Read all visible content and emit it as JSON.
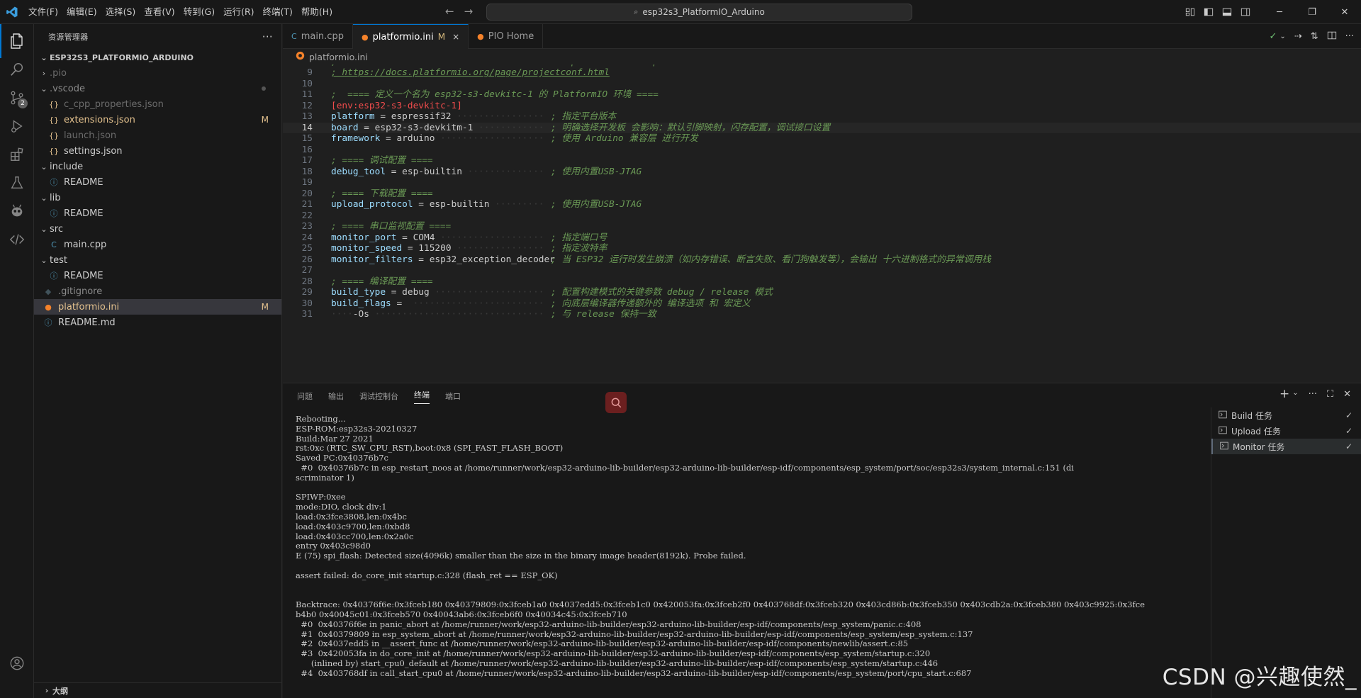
{
  "menu": [
    "文件(F)",
    "编辑(E)",
    "选择(S)",
    "查看(V)",
    "转到(G)",
    "运行(R)",
    "终端(T)",
    "帮助(H)"
  ],
  "search": {
    "text": "esp32s3_PlatformIO_Arduino"
  },
  "sidebar": {
    "title": "资源管理器",
    "more": "···",
    "project": "ESP32S3_PLATFORMIO_ARDUINO",
    "outline": "大纲"
  },
  "tree": [
    {
      "label": ".pio",
      "depth": 1,
      "type": "folder",
      "open": false,
      "color": "#6b6b6b"
    },
    {
      "label": ".vscode",
      "depth": 1,
      "type": "folder",
      "open": true,
      "color": "#8a8a8a",
      "dot": true
    },
    {
      "label": "c_cpp_properties.json",
      "depth": 2,
      "type": "json",
      "color": "#6b6b6b"
    },
    {
      "label": "extensions.json",
      "depth": 2,
      "type": "json",
      "color": "#e2c08d",
      "status": "M"
    },
    {
      "label": "launch.json",
      "depth": 2,
      "type": "json",
      "color": "#6b6b6b"
    },
    {
      "label": "settings.json",
      "depth": 2,
      "type": "json",
      "color": "#cccccc"
    },
    {
      "label": "include",
      "depth": 1,
      "type": "folder",
      "open": true,
      "color": "#cccccc"
    },
    {
      "label": "README",
      "depth": 2,
      "type": "info",
      "color": "#cccccc"
    },
    {
      "label": "lib",
      "depth": 1,
      "type": "folder",
      "open": true,
      "color": "#cccccc"
    },
    {
      "label": "README",
      "depth": 2,
      "type": "info",
      "color": "#cccccc"
    },
    {
      "label": "src",
      "depth": 1,
      "type": "folder",
      "open": true,
      "color": "#cccccc"
    },
    {
      "label": "main.cpp",
      "depth": 2,
      "type": "cpp",
      "color": "#cccccc"
    },
    {
      "label": "test",
      "depth": 1,
      "type": "folder",
      "open": true,
      "color": "#cccccc"
    },
    {
      "label": "README",
      "depth": 2,
      "type": "info",
      "color": "#cccccc"
    },
    {
      "label": ".gitignore",
      "depth": 1,
      "type": "git",
      "color": "#8a8a8a"
    },
    {
      "label": "platformio.ini",
      "depth": 1,
      "type": "pio",
      "color": "#e2c08d",
      "status": "M",
      "selected": true
    },
    {
      "label": "README.md",
      "depth": 1,
      "type": "info",
      "color": "#cccccc"
    }
  ],
  "tabs": [
    {
      "label": "main.cpp",
      "icon": "cpp",
      "active": false
    },
    {
      "label": "platformio.ini",
      "icon": "pio",
      "active": true,
      "modified": "M",
      "close": "×"
    },
    {
      "label": "PIO Home",
      "icon": "pio",
      "active": false
    }
  ],
  "breadcrumb": "platformio.ini",
  "code_lines": [
    {
      "n": "",
      "partial": true,
      "text": "; Please visit documentation for the other options and examples",
      "cls": "c-cmt"
    },
    {
      "n": "9",
      "text": "; https://docs.platformio.org/page/projectconf.html",
      "cls": "link"
    },
    {
      "n": "10",
      "text": ""
    },
    {
      "n": "11",
      "text": ";  ==== 定义一个名为 esp32-s3-devkitc-1 的 PlatformIO 环境 ====",
      "cls": "c-cmt"
    },
    {
      "n": "12",
      "text": "[env:esp32-s3-devkitc-1]",
      "cls": "c-sec"
    },
    {
      "n": "13",
      "key": "platform",
      "val": "espressif32",
      "comment": "; 指定平台版本"
    },
    {
      "n": "14",
      "key": "board",
      "val": "esp32-s3-devkitm-1",
      "comment": "; 明确选择开发板 会影响：默认引脚映射，闪存配置，调试接口设置",
      "current": true
    },
    {
      "n": "15",
      "key": "framework",
      "val": "arduino",
      "comment": "; 使用 Arduino 兼容层 进行开发"
    },
    {
      "n": "16",
      "text": ""
    },
    {
      "n": "17",
      "text": "; ==== 调试配置 ====",
      "cls": "c-cmt"
    },
    {
      "n": "18",
      "key": "debug_tool",
      "val": "esp-builtin",
      "comment": "; 使用内置USB-JTAG"
    },
    {
      "n": "19",
      "text": ""
    },
    {
      "n": "20",
      "text": "; ==== 下载配置 ====",
      "cls": "c-cmt"
    },
    {
      "n": "21",
      "key": "upload_protocol",
      "val": "esp-builtin",
      "comment": "; 使用内置USB-JTAG"
    },
    {
      "n": "22",
      "text": ""
    },
    {
      "n": "23",
      "text": "; ==== 串口监视配置 ====",
      "cls": "c-cmt"
    },
    {
      "n": "24",
      "key": "monitor_port",
      "val": "COM4",
      "comment": "; 指定端口号"
    },
    {
      "n": "25",
      "key": "monitor_speed",
      "val": "115200",
      "comment": "; 指定波特率"
    },
    {
      "n": "26",
      "key": "monitor_filters",
      "val": "esp32_exception_decoder",
      "comment": "; 当 ESP32 运行时发生崩溃（如内存错误、断言失败、看门狗触发等），会输出 十六进制格式的异常调用栈"
    },
    {
      "n": "27",
      "text": ""
    },
    {
      "n": "28",
      "text": "; ==== 编译配置 ====",
      "cls": "c-cmt"
    },
    {
      "n": "29",
      "key": "build_type",
      "val": "debug",
      "comment": "; 配置构建模式的关键参数 debug / release 模式"
    },
    {
      "n": "30",
      "key": "build_flags",
      "val": "",
      "comment": "; 向底层编译器传递额外的 编译选项 和 宏定义"
    },
    {
      "n": "31",
      "indent": "    ",
      "plain": "-Os",
      "comment": "; 与 release 保持一致"
    }
  ],
  "panel": {
    "tabs": [
      "问题",
      "输出",
      "调试控制台",
      "终端",
      "端口"
    ],
    "active_tab": "终端",
    "add": "+",
    "more": "···"
  },
  "terminal_lines": [
    "Rebooting...",
    "ESP-ROM:esp32s3-20210327",
    "Build:Mar 27 2021",
    "rst:0xc (RTC_SW_CPU_RST),boot:0x8 (SPI_FAST_FLASH_BOOT)",
    "Saved PC:0x40376b7c",
    "  #0  0x40376b7c in esp_restart_noos at /home/runner/work/esp32-arduino-lib-builder/esp32-arduino-lib-builder/esp-idf/components/esp_system/port/soc/esp32s3/system_internal.c:151 (di",
    "scriminator 1)",
    "",
    "SPIWP:0xee",
    "mode:DIO, clock div:1",
    "load:0x3fce3808,len:0x4bc",
    "load:0x403c9700,len:0xbd8",
    "load:0x403cc700,len:0x2a0c",
    "entry 0x403c98d0",
    "E (75) spi_flash: Detected size(4096k) smaller than the size in the binary image header(8192k). Probe failed.",
    "",
    "assert failed: do_core_init startup.c:328 (flash_ret == ESP_OK)",
    "",
    "",
    "Backtrace: 0x40376f6e:0x3fceb180 0x40379809:0x3fceb1a0 0x4037edd5:0x3fceb1c0 0x420053fa:0x3fceb2f0 0x403768df:0x3fceb320 0x403cd86b:0x3fceb350 0x403cdb2a:0x3fceb380 0x403c9925:0x3fce",
    "b4b0 0x40045c01:0x3fceb570 0x40043ab6:0x3fceb6f0 0x40034c45:0x3fceb710",
    "  #0  0x40376f6e in panic_abort at /home/runner/work/esp32-arduino-lib-builder/esp32-arduino-lib-builder/esp-idf/components/esp_system/panic.c:408",
    "  #1  0x40379809 in esp_system_abort at /home/runner/work/esp32-arduino-lib-builder/esp32-arduino-lib-builder/esp-idf/components/esp_system/esp_system.c:137",
    "  #2  0x4037edd5 in __assert_func at /home/runner/work/esp32-arduino-lib-builder/esp32-arduino-lib-builder/esp-idf/components/newlib/assert.c:85",
    "  #3  0x420053fa in do_core_init at /home/runner/work/esp32-arduino-lib-builder/esp32-arduino-lib-builder/esp-idf/components/esp_system/startup.c:320",
    "      (inlined by) start_cpu0_default at /home/runner/work/esp32-arduino-lib-builder/esp32-arduino-lib-builder/esp-idf/components/esp_system/startup.c:446",
    "  #4  0x403768df in call_start_cpu0 at /home/runner/work/esp32-arduino-lib-builder/esp32-arduino-lib-builder/esp-idf/components/esp_system/port/cpu_start.c:687"
  ],
  "tasks": [
    {
      "label": "Build 任务",
      "check": "✓"
    },
    {
      "label": "Upload 任务",
      "check": "✓"
    },
    {
      "label": "Monitor 任务",
      "check": "✓",
      "selected": true
    }
  ],
  "watermark": "CSDN @兴趣使然_",
  "colors": {
    "accent": "#0078d4",
    "modified": "#e2c08d",
    "comment": "#6a9955",
    "section": "#f14c4c",
    "key": "#9cdcfe"
  }
}
